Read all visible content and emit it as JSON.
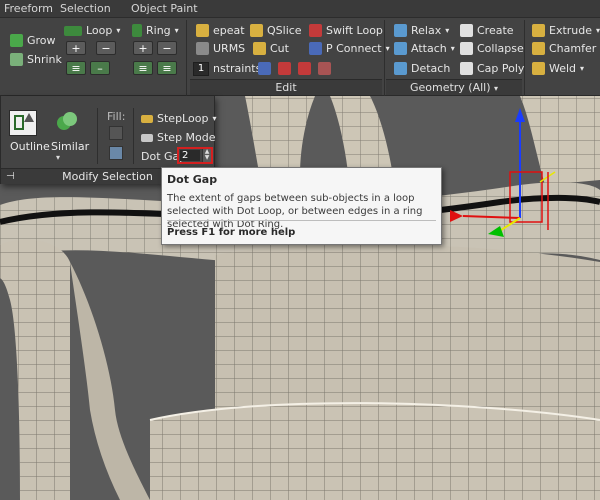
{
  "tabs": [
    {
      "label": "Freeform"
    },
    {
      "label": "Selection"
    },
    {
      "label": "Object Paint"
    }
  ],
  "ribbon": {
    "grow": "Grow",
    "shrink": "Shrink",
    "loop": "Loop",
    "ring": "Ring",
    "repeat": "epeat",
    "qslice": "QSlice",
    "swift_loop": "Swift Loop",
    "nurms": "URMS",
    "cut": "Cut",
    "p_connect": "P Connect",
    "constraints": "nstraints:",
    "constraint_value": "1",
    "edit_label": "Edit",
    "relax": "Relax",
    "create": "Create",
    "attach": "Attach",
    "collapse": "Collapse",
    "detach": "Detach",
    "cap_poly": "Cap Poly",
    "geometry_label": "Geometry (All)",
    "extrude": "Extrude",
    "chamfer": "Chamfer",
    "weld": "Weld"
  },
  "modify_selection": {
    "outline": "Outline",
    "similar": "Similar",
    "fill": "Fill:",
    "step_loop": "StepLoop",
    "step_mode": "Step Mode",
    "dot_gap_label": "Dot Gap:",
    "dot_gap_value": "2",
    "footer": "Modify Selection",
    "pin": "⊣"
  },
  "tooltip": {
    "title": "Dot Gap",
    "body": "The extent of gaps between sub-objects in a loop selected with Dot Loop, or between edges in a ring selected with Dot Ring.",
    "help": "Press F1 for more help"
  },
  "colors": {
    "accent_red": "#d42020",
    "gizmo_z": "#1a3cff",
    "gizmo_x": "#e01010",
    "gizmo_y": "#00c000"
  }
}
